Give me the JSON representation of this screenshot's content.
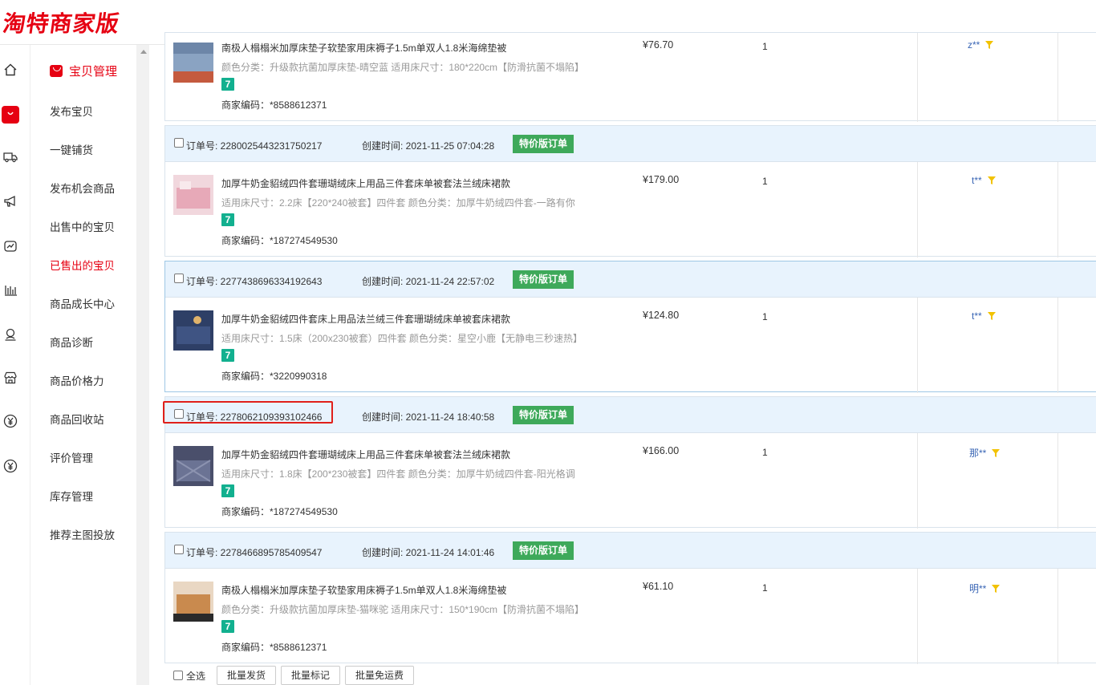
{
  "app": {
    "logo": "淘特商家版"
  },
  "sidebar": {
    "section_title": "宝贝管理",
    "items": [
      {
        "label": "发布宝贝",
        "active": false
      },
      {
        "label": "一键铺货",
        "active": false
      },
      {
        "label": "发布机会商品",
        "active": false
      },
      {
        "label": "出售中的宝贝",
        "active": false
      },
      {
        "label": "已售出的宝贝",
        "active": true
      },
      {
        "label": "商品成长中心",
        "active": false
      },
      {
        "label": "商品诊断",
        "active": false
      },
      {
        "label": "商品价格力",
        "active": false
      },
      {
        "label": "商品回收站",
        "active": false
      },
      {
        "label": "评价管理",
        "active": false
      },
      {
        "label": "库存管理",
        "active": false
      },
      {
        "label": "推荐主图投放",
        "active": false
      }
    ]
  },
  "rail_icons": [
    "home-icon",
    "bag-icon",
    "truck-icon",
    "megaphone-icon",
    "chart-icon",
    "bar-chart-icon",
    "user-icon",
    "shop-icon",
    "yen-icon",
    "yen-icon"
  ],
  "orders": [
    {
      "order_no": "",
      "created": "",
      "tag": "",
      "product": "南极人榻榻米加厚床垫子软垫家用床褥子1.5m单双人1.8米海绵垫被",
      "spec": "颜色分类：升级款抗菌加厚床垫-晴空蓝  适用床尺寸：180*220cm【防滑抗菌不塌陷】",
      "badge": "7",
      "code": "商家编码：*8588612371",
      "price": "¥76.70",
      "qty": "1",
      "buyer": "z**",
      "thumb_color": "#6d86a8"
    },
    {
      "order_no": "订单号: 2280025443231750217",
      "created": "创建时间: 2021-11-25 07:04:28",
      "tag": "特价版订单",
      "product": "加厚牛奶金貂绒四件套珊瑚绒床上用品三件套床单被套法兰绒床裙款",
      "spec": "适用床尺寸：2.2床【220*240被套】四件套  颜色分类：加厚牛奶绒四件套-一路有你",
      "badge": "7",
      "code": "商家编码：*187274549530",
      "price": "¥179.00",
      "qty": "1",
      "buyer": "t**",
      "thumb_color": "#e7a9b8"
    },
    {
      "order_no": "订单号: 2277438696334192643",
      "created": "创建时间: 2021-11-24 22:57:02",
      "tag": "特价版订单",
      "product": "加厚牛奶金貂绒四件套床上用品法兰绒三件套珊瑚绒床单被套床裙款",
      "spec": "适用床尺寸：1.5床（200x230被套）四件套  颜色分类：星空小鹿【无静电三秒速热】",
      "badge": "7",
      "code": "商家编码：*3220990318",
      "price": "¥124.80",
      "qty": "1",
      "buyer": "t**",
      "thumb_color": "#2e3f66"
    },
    {
      "order_no": "订单号: 2278062109393102466",
      "created": "创建时间: 2021-11-24 18:40:58",
      "tag": "特价版订单",
      "product": "加厚牛奶金貂绒四件套珊瑚绒床上用品三件套床单被套法兰绒床裙款",
      "spec": "适用床尺寸：1.8床【200*230被套】四件套  颜色分类：加厚牛奶绒四件套-阳光格调",
      "badge": "7",
      "code": "商家编码：*187274549530",
      "price": "¥166.00",
      "qty": "1",
      "buyer": "那**",
      "thumb_color": "#4a4f6b"
    },
    {
      "order_no": "订单号: 2278466895785409547",
      "created": "创建时间: 2021-11-24 14:01:46",
      "tag": "特价版订单",
      "product": "南极人榻榻米加厚床垫子软垫家用床褥子1.5m单双人1.8米海绵垫被",
      "spec": "颜色分类：升级款抗菌加厚床垫-猫咪驼  适用床尺寸：150*190cm【防滑抗菌不塌陷】",
      "badge": "7",
      "code": "商家编码：*8588612371",
      "price": "¥61.10",
      "qty": "1",
      "buyer": "明**",
      "thumb_color": "#c98a4e"
    }
  ],
  "footer": {
    "select_all": "全选",
    "buttons": [
      "批量发货",
      "批量标记",
      "批量免运费"
    ]
  },
  "colors": {
    "brand_red": "#e60012",
    "tag_green": "#3ea95a",
    "badge_teal": "#12b08f",
    "buyer_blue": "#3a66b5",
    "flag_yellow": "#f2c200"
  }
}
